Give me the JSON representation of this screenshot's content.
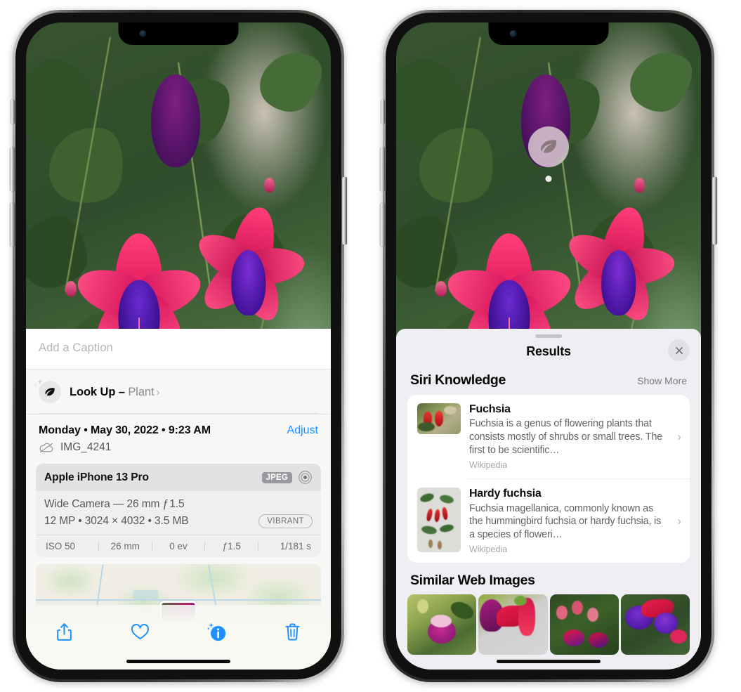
{
  "left_phone": {
    "caption": {
      "placeholder": "Add a Caption",
      "value": ""
    },
    "lookup": {
      "label": "Look Up – ",
      "subject": "Plant",
      "chevron": "›",
      "icon": "leaf-icon",
      "sparkle_icon": "sparkle-icon"
    },
    "date": {
      "text": "Monday • May 30, 2022 • 9:23 AM",
      "adjust_label": "Adjust"
    },
    "file": {
      "name": "IMG_4241",
      "icon": "icloud-slash-icon"
    },
    "camera": {
      "device": "Apple iPhone 13 Pro",
      "format_badge": "JPEG",
      "raw_icon": "aperture-icon",
      "lens_line": "Wide Camera — 26 mm ƒ 1.5",
      "spec_line": "12 MP • 3024 × 4032 • 3.5 MB",
      "style_badge": "VIBRANT",
      "exif": [
        "ISO 50",
        "26 mm",
        "0 ev",
        "ƒ1.5",
        "1/181 s"
      ]
    },
    "toolbar": [
      {
        "name": "share-button",
        "icon": "share-icon"
      },
      {
        "name": "favorite-button",
        "icon": "heart-icon"
      },
      {
        "name": "info-button",
        "icon": "info-sparkle-icon"
      },
      {
        "name": "delete-button",
        "icon": "trash-icon"
      }
    ],
    "colors": {
      "accent": "#1e8fff",
      "sheet_bg": "#f7f7f6",
      "card_bg": "#efeff0"
    }
  },
  "right_phone": {
    "badge": {
      "icon": "leaf-icon"
    },
    "sheet": {
      "title": "Results",
      "close_icon": "close-icon",
      "grabber": "drag-handle"
    },
    "siri_knowledge": {
      "title": "Siri Knowledge",
      "show_more": "Show More",
      "results": [
        {
          "title": "Fuchsia",
          "description": "Fuchsia is a genus of flowering plants that consists mostly of shrubs or small trees. The first to be scientific…",
          "source": "Wikipedia",
          "chevron": "›"
        },
        {
          "title": "Hardy fuchsia",
          "description": "Fuchsia magellanica, commonly known as the hummingbird fuchsia or hardy fuchsia, is a species of floweri…",
          "source": "Wikipedia",
          "chevron": "›"
        }
      ]
    },
    "similar_web_images": {
      "title": "Similar Web Images",
      "tiles": [
        {
          "name": "web-image-1"
        },
        {
          "name": "web-image-2"
        },
        {
          "name": "web-image-3"
        },
        {
          "name": "web-image-4"
        }
      ]
    },
    "colors": {
      "sheet_bg": "#eeeef3",
      "card_bg": "#ffffff",
      "secondary_text": "#636366"
    }
  }
}
